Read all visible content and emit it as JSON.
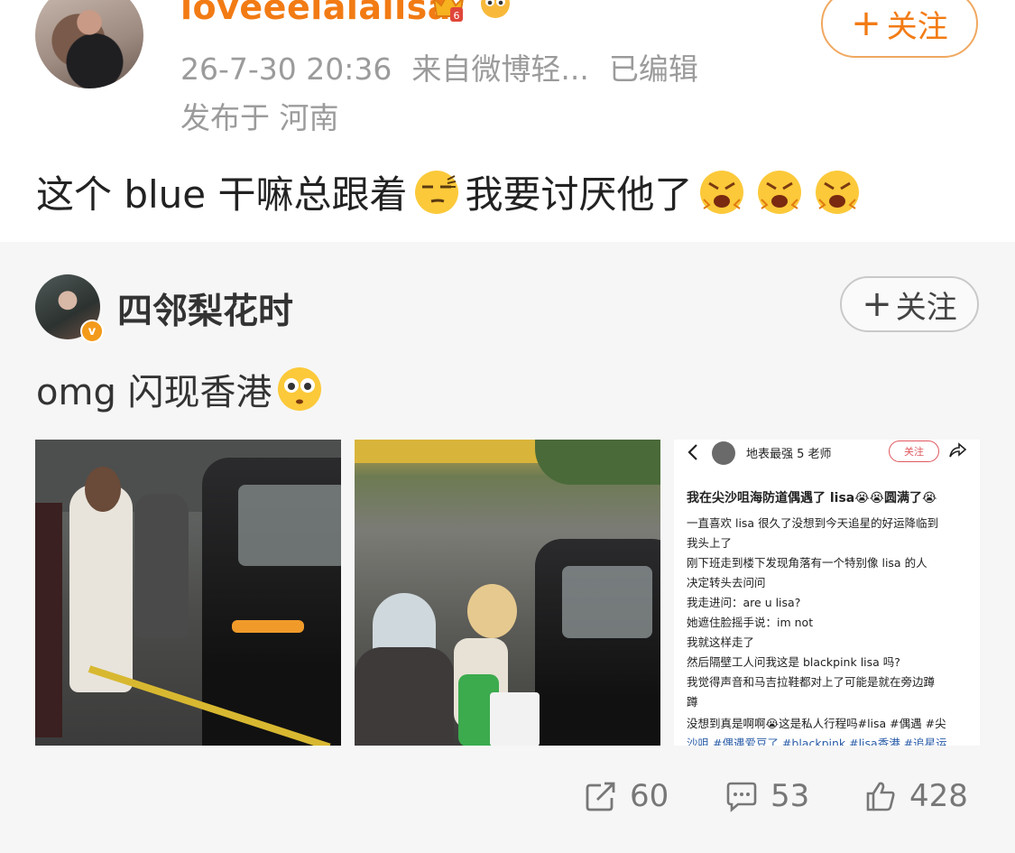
{
  "post": {
    "username": "loveeelalalisa",
    "timestamp": "26-7-30 20:36",
    "source": "来自微博轻...",
    "edited": "已编辑",
    "location": "发布于 河南",
    "follow_label": "关注",
    "text_part1": "这个 blue 干嘛总跟着",
    "text_part2": "我要讨厌他了"
  },
  "repost": {
    "author": "四邻梨花时",
    "follow_label": "关注",
    "text": "omg 闪现香港",
    "screenshot": {
      "account": "地表最强 5 老师",
      "follow_label": "关注",
      "title": "我在尖沙咀海防道偶遇了 lisa😭😭圆满了😭",
      "lines": [
        "一直喜欢 lisa 很久了没想到今天追星的好运降临到",
        "我头上了",
        "刚下班走到楼下发现角落有一个特别像 lisa 的人",
        "决定转头去问问",
        "我走进问：are u lisa?",
        "她遮住脸摇手说：im not",
        "我就这样走了",
        "然后隔壁工人问我这是 blackpink lisa 吗?",
        "我觉得声音和马吉拉鞋都对上了可能是就在旁边蹲",
        "蹲",
        "没想到真是啊啊😭这是私人行程吗#lisa #偶遇 #尖",
        "沙咀 #偶遇爱豆了 #blackpink #lisa香港 #追星运"
      ]
    }
  },
  "stats": {
    "reposts": "60",
    "comments": "53",
    "likes": "428"
  },
  "colors": {
    "accent": "#f27b14",
    "repost_bg": "#f6f6f6"
  }
}
